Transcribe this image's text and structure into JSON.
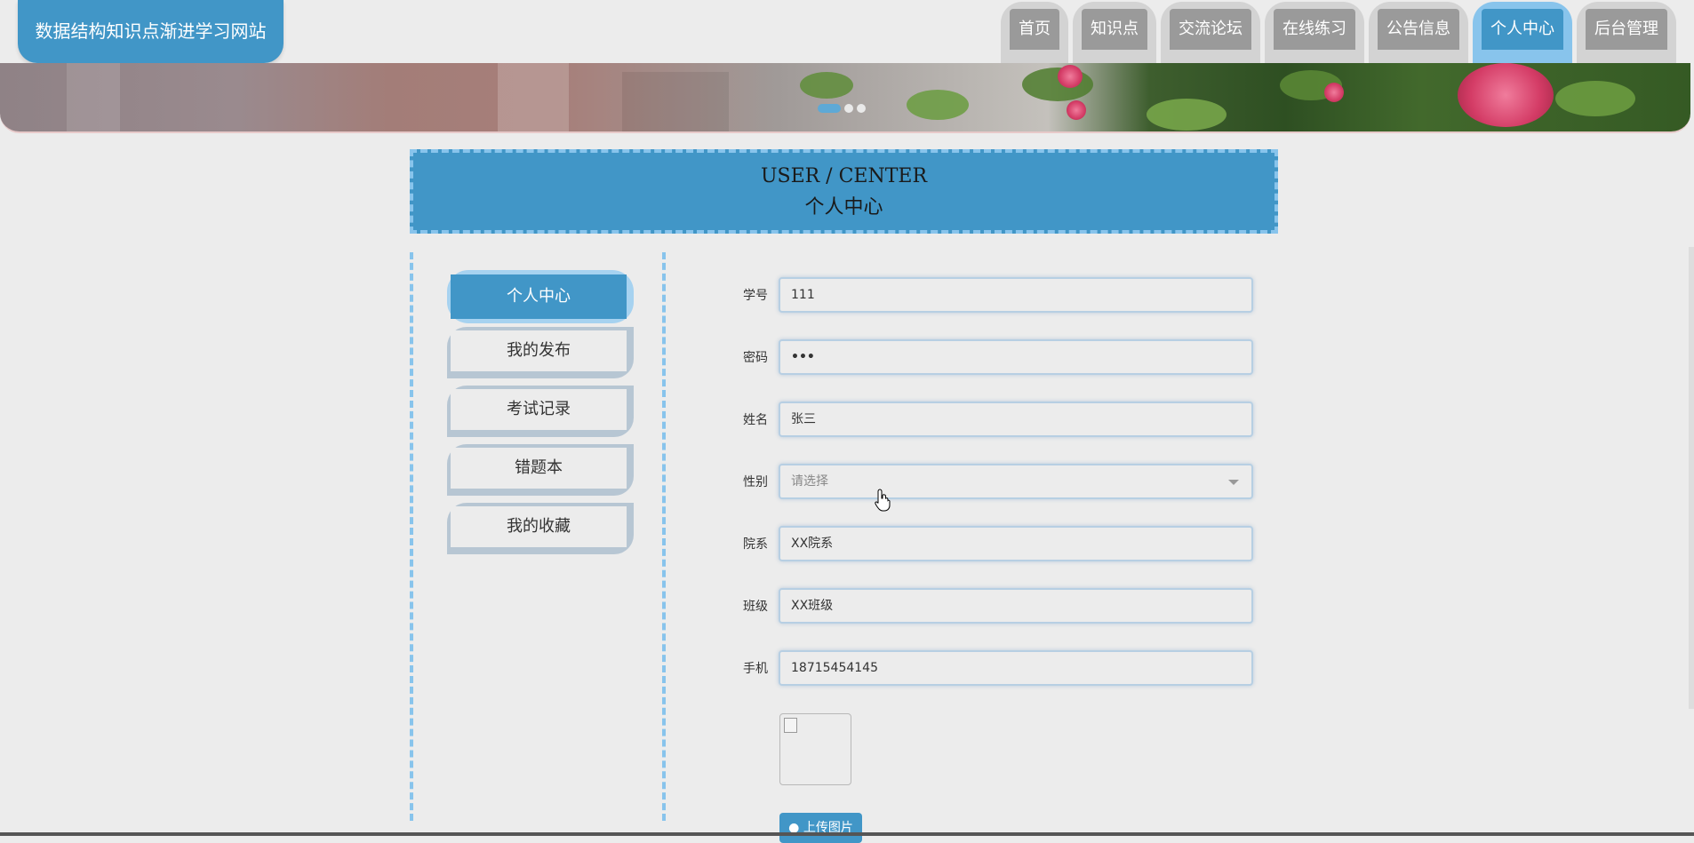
{
  "site": {
    "title": "数据结构知识点渐进学习网站"
  },
  "nav": [
    {
      "label": "首页",
      "active": false
    },
    {
      "label": "知识点",
      "active": false
    },
    {
      "label": "交流论坛",
      "active": false
    },
    {
      "label": "在线练习",
      "active": false
    },
    {
      "label": "公告信息",
      "active": false
    },
    {
      "label": "个人中心",
      "active": true
    },
    {
      "label": "后台管理",
      "active": false
    }
  ],
  "banner": {
    "slide_count": 3,
    "active_slide": 1
  },
  "heading": {
    "en": "USER / CENTER",
    "cn": "个人中心"
  },
  "sidemenu": [
    {
      "label": "个人中心",
      "active": true
    },
    {
      "label": "我的发布",
      "active": false
    },
    {
      "label": "考试记录",
      "active": false
    },
    {
      "label": "错题本",
      "active": false
    },
    {
      "label": "我的收藏",
      "active": false
    }
  ],
  "form": {
    "student_id": {
      "label": "学号",
      "value": "111"
    },
    "password": {
      "label": "密码",
      "value": "•••"
    },
    "name": {
      "label": "姓名",
      "value": "张三"
    },
    "gender": {
      "label": "性别",
      "placeholder": "请选择"
    },
    "department": {
      "label": "院系",
      "value": "XX院系"
    },
    "class": {
      "label": "班级",
      "value": "XX班级"
    },
    "phone": {
      "label": "手机",
      "value": "18715454145"
    }
  },
  "upload": {
    "button_label": "上传图片"
  },
  "colors": {
    "primary": "#4196c7",
    "primary_light": "#88c4ec",
    "nav_inactive": "#9a9a9a",
    "background": "#ececec"
  }
}
